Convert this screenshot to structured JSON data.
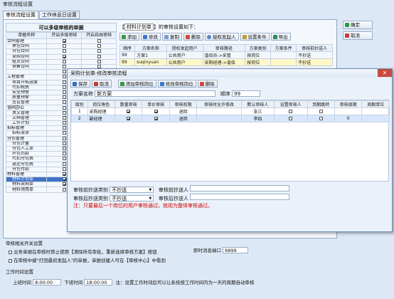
{
  "window_title": "审核流程设置",
  "tabs": [
    "审核流程设置",
    "工作休息日设置"
  ],
  "left": {
    "header": "可以多级审核的单据",
    "cols": [
      "单据名称",
      "开启多级审核",
      "开启自由审核"
    ],
    "rows": [
      {
        "name": "合同管理",
        "g": true,
        "a": true,
        "b": false
      },
      {
        "name": "承包合同",
        "g": false,
        "a": false,
        "b": false
      },
      {
        "name": "分包合同",
        "g": false,
        "a": false,
        "b": false
      },
      {
        "name": "采购合同",
        "g": false,
        "a": true,
        "b": false
      },
      {
        "name": "租赁合同",
        "g": false,
        "a": false,
        "b": false
      },
      {
        "name": "销售合同",
        "g": false,
        "a": false,
        "b": false
      },
      {
        "name": "",
        "g": false,
        "a": false,
        "b": false
      },
      {
        "name": "工程管理",
        "g": true,
        "a": false,
        "b": false
      },
      {
        "name": "项目开拓进度",
        "g": false,
        "a": false,
        "b": false
      },
      {
        "name": "代扣税费",
        "g": false,
        "a": false,
        "b": false
      },
      {
        "name": "安全预警",
        "g": false,
        "a": false,
        "b": false
      },
      {
        "name": "质量预警",
        "g": false,
        "a": false,
        "b": false
      },
      {
        "name": "签证管理",
        "g": false,
        "a": false,
        "b": false
      },
      {
        "name": "协同办公",
        "g": true,
        "a": false,
        "b": false
      },
      {
        "name": "发文管理",
        "g": false,
        "a": false,
        "b": false
      },
      {
        "name": "文档管理",
        "g": false,
        "a": false,
        "b": false
      },
      {
        "name": "工作计划",
        "g": false,
        "a": false,
        "b": false
      },
      {
        "name": "招标管理",
        "g": true,
        "a": false,
        "b": false
      },
      {
        "name": "招标清单",
        "g": false,
        "a": false,
        "b": false
      },
      {
        "name": "分包管理",
        "g": true,
        "a": false,
        "b": false
      },
      {
        "name": "分包计量",
        "g": false,
        "a": false,
        "b": false
      },
      {
        "name": "分包人工单",
        "g": false,
        "a": false,
        "b": false
      },
      {
        "name": "外包罚款",
        "g": false,
        "a": false,
        "b": false
      },
      {
        "name": "代扣分包费",
        "g": false,
        "a": false,
        "b": false
      },
      {
        "name": "返还分包费",
        "g": false,
        "a": false,
        "b": false
      },
      {
        "name": "分包付款",
        "g": false,
        "a": false,
        "b": false
      },
      {
        "name": "材料管理",
        "g": true,
        "a": true,
        "b": false
      },
      {
        "name": "材料计划单",
        "g": false,
        "a": true,
        "b": false,
        "sel": true
      },
      {
        "name": "材料采购单",
        "g": false,
        "a": true,
        "b": false
      },
      {
        "name": "材料领用单",
        "g": false,
        "a": false,
        "b": false
      }
    ]
  },
  "right": {
    "title_pre": "【",
    "title_item": "材料计划单",
    "title_post": "】的审核设置如下：",
    "toolbar": [
      "添加",
      "修改",
      "复制",
      "删除",
      "授权发起人",
      "设置条件",
      "导出"
    ],
    "cols": [
      "顺序",
      "方案名称",
      "授权发起用户",
      "审核路径",
      "方案类别",
      "方案条件",
      "审核前抄送人"
    ],
    "rows": [
      [
        "99",
        "方案1",
        "公共用户",
        "谐佰员->采管",
        "按岗位",
        "",
        "不抄送"
      ],
      [
        "99",
        "suqinyuan",
        "公共用户",
        "采购经理->谐佰",
        "按岗位",
        "",
        "不抄送"
      ]
    ]
  },
  "ok": "确定",
  "cancel": "取消",
  "dialog": {
    "title": "采购计划单-修改审核流程",
    "toolbar": [
      "保存",
      "取消",
      "添加审核岗位",
      "修改审核岗位",
      "删除"
    ],
    "scheme_label": "方案名称",
    "scheme_value": "新方案",
    "order_label": "顺序",
    "order_value": "99",
    "cols": [
      "级别",
      "岗位角色",
      "数量审核",
      "单价审核",
      "审核权限",
      "审核时允许修改",
      "默认审核人",
      "设置审核人",
      "到期跳转",
      "审核周期",
      "周期单位"
    ],
    "rows": [
      [
        "1",
        "采购经理",
        "",
        "",
        "退回",
        "",
        "张三",
        "",
        "",
        "",
        ""
      ],
      [
        "2",
        "副经理",
        "",
        "",
        "退回",
        "",
        "李四",
        "",
        "",
        "0",
        ""
      ]
    ],
    "checks": [
      [
        true,
        true,
        false,
        false
      ],
      [
        true,
        true,
        false,
        false
      ]
    ],
    "cc1_label": "审核前抄送类别",
    "cc1_value": "不抄送",
    "cc1b_label": "审核前抄送人",
    "cc2_label": "审核后抄送类别",
    "cc2_value": "不抄送",
    "cc2b_label": "审核后抄送人",
    "note": "注：只要最后一个岗位的用户审核通过，就视为整体审核通过。"
  },
  "bottom": {
    "sec1": "审核相关开关设置",
    "opt1": "业务单据在审核时禁止使用【清除所有审批，重新选择审核方案】按钮",
    "opt2": "在审核中被\"打回最初发起人\"的单据，单据创建人可在【审核中心】中看到",
    "port_label": "即时消息端口",
    "port_value": "6899",
    "sec2": "工作时间设置",
    "start_label": "上班时间",
    "start": "8:00:00",
    "end_label": "下班时间",
    "end": "18:00:00",
    "note": "注：设置工作时间后可以让系统按工作时间内为一天的周期自动审核"
  }
}
